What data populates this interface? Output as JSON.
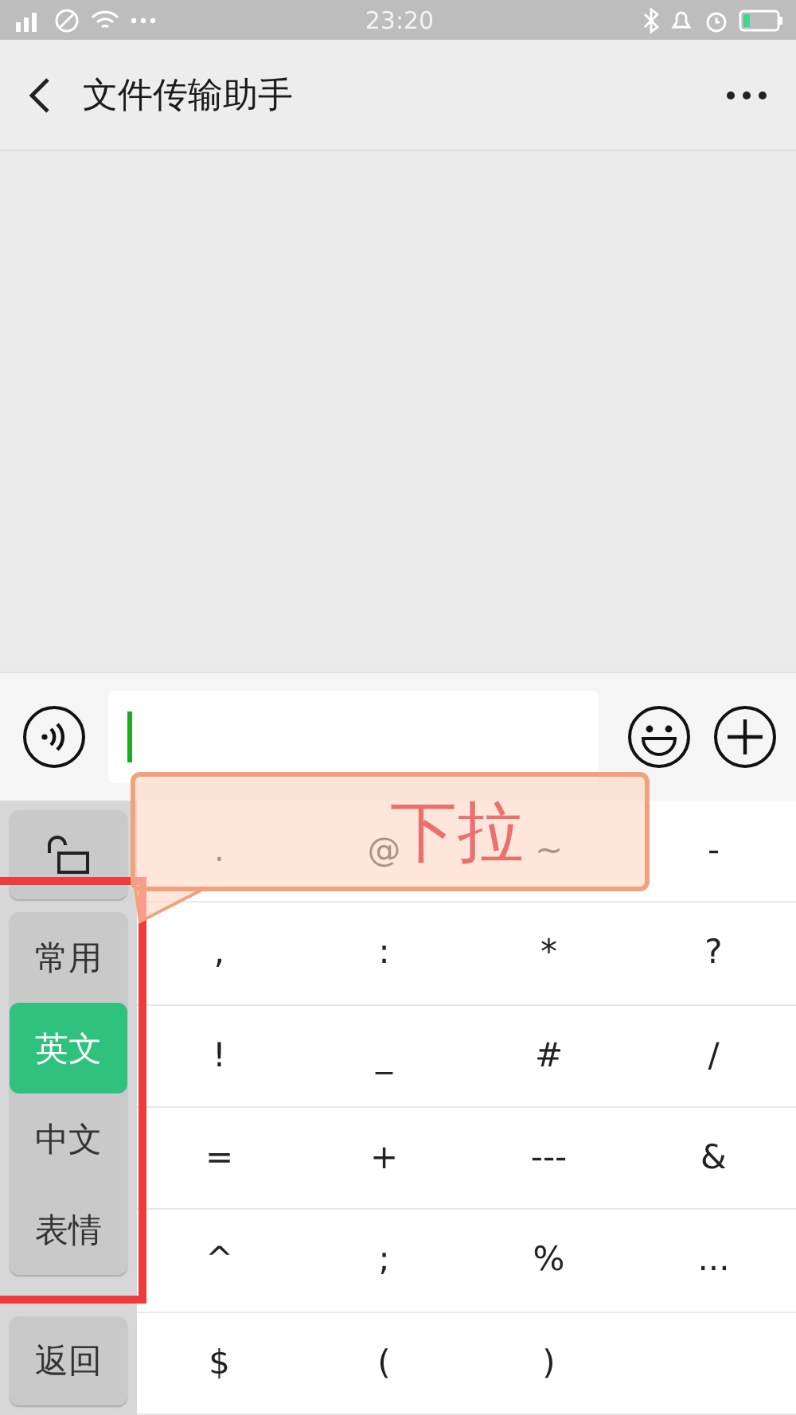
{
  "status_bar": {
    "time": "23:20"
  },
  "header": {
    "title": "文件传输助手"
  },
  "input_bar": {
    "focused": true
  },
  "keyboard": {
    "categories": [
      {
        "label": "常用",
        "selected": false
      },
      {
        "label": "英文",
        "selected": true
      },
      {
        "label": "中文",
        "selected": false
      },
      {
        "label": "表情",
        "selected": false
      }
    ],
    "back_label": "返回",
    "rows": [
      [
        ".",
        "@",
        "~",
        "-"
      ],
      [
        ",",
        ":",
        "*",
        "?"
      ],
      [
        "!",
        "_",
        "#",
        "/"
      ],
      [
        "=",
        "+",
        "---",
        "&"
      ],
      [
        "^",
        ";",
        "%",
        "..."
      ],
      [
        "$",
        "(",
        ")"
      ]
    ]
  },
  "annotation": {
    "callout": "下拉",
    "highlight_categories": true
  }
}
